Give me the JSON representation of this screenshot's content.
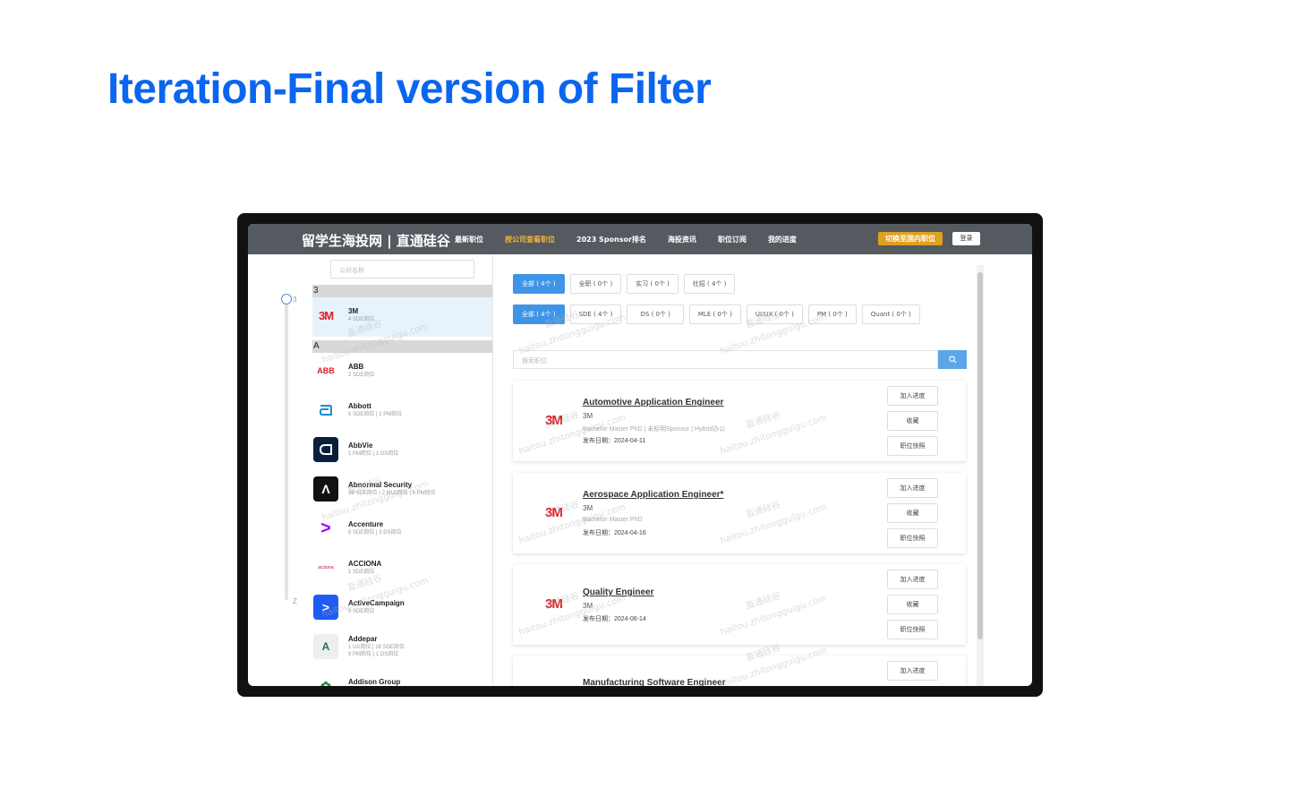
{
  "slide_title": "Iteration-Final version of Filter",
  "nav": {
    "brand": "留学生海投网 | 直通硅谷",
    "links": [
      "最新职位",
      "按公司查看职位",
      "2023 Sponsor排名",
      "海投资讯",
      "职位订阅",
      "我的进度"
    ],
    "active_index": 1,
    "switch_label": "切换至国内职位",
    "login_label": "登录"
  },
  "left": {
    "search_placeholder": "公司名称",
    "scroller_top": "3",
    "scroller_bottom": "Z",
    "groups": [
      {
        "letter": "3",
        "companies": [
          {
            "name": "3M",
            "count": "4 SDE岗位",
            "logo": "3M",
            "selected": true
          }
        ]
      },
      {
        "letter": "A",
        "companies": [
          {
            "name": "ABB",
            "count": "2 SDE岗位",
            "logo": "ABB"
          },
          {
            "name": "Abbott",
            "count": "5 SDE岗位 | 1 PM岗位",
            "logo": "a"
          },
          {
            "name": "AbbVie",
            "count": "1 PM岗位 | 1 DS岗位",
            "logo": "a"
          },
          {
            "name": "Abnormal Security",
            "count": "39 SDE岗位 | 2 MLE岗位 | 6 PM岗位",
            "logo": "Λ"
          },
          {
            "name": "Accenture",
            "count": "5 SDE岗位 | 3 DS岗位",
            "logo": ">"
          },
          {
            "name": "ACCIONA",
            "count": "1 SDE岗位",
            "logo": "acciona"
          },
          {
            "name": "ActiveCampaign",
            "count": "9 SDE岗位",
            "logo": ">"
          },
          {
            "name": "Addepar",
            "count": "1 UX岗位 | 16 SDE岗位",
            "count2": "9 PM岗位 | 1 DS岗位",
            "logo": "A"
          },
          {
            "name": "Addison Group",
            "count": "",
            "logo": "✿"
          }
        ]
      }
    ]
  },
  "filters": {
    "type_row": [
      "全部 ( 4个 )",
      "全职 ( 0个 )",
      "实习 ( 0个 )",
      "社招 ( 4个 )"
    ],
    "role_row": [
      "全部 ( 4个 )",
      "SDE ( 4个 )",
      "DS ( 0个 )",
      "MLE ( 0个 )",
      "UI/UX ( 0个 )",
      "PM ( 0个 )",
      "Quant ( 0个 )"
    ],
    "search_placeholder": "搜索职位"
  },
  "job_actions": [
    "加入进度",
    "收藏",
    "职位快照"
  ],
  "jobs": [
    {
      "title": "Automotive Application Engineer",
      "company": "3M",
      "tags": "Bachelor Master PhD | 未标明Sponsor | Hybrid办公",
      "date": "发布日期：2024-04-11",
      "logo": "3M"
    },
    {
      "title": "Aerospace Application Engineer*",
      "company": "3M",
      "tags": "Bachelor Master PhD",
      "date": "发布日期：2024-04-16",
      "logo": "3M"
    },
    {
      "title": "Quality Engineer",
      "company": "3M",
      "tags": "",
      "date": "发布日期：2024-06-14",
      "logo": "3M"
    },
    {
      "title": "Manufacturing Software Engineer",
      "company": "",
      "tags": "",
      "date": "",
      "logo": ""
    }
  ],
  "watermark": {
    "cn": "直通硅谷",
    "url": "haitou.zhitongguigu.com"
  },
  "colors": {
    "title_blue": "#0a66f0",
    "nav_bg": "#555a60",
    "nav_active": "#f0b43a",
    "switch_bg": "#e0a020",
    "chip_active": "#3e95e8",
    "brand_red": "#e01a22"
  }
}
